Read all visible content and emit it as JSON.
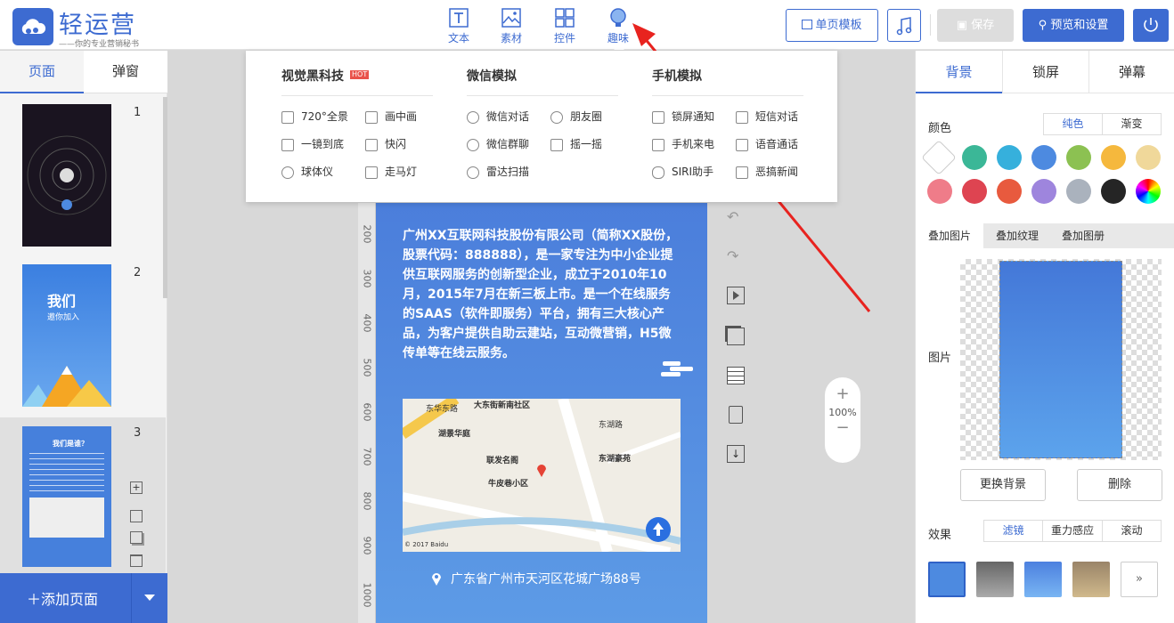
{
  "app": {
    "name": "轻运营",
    "slogan": "——你的专业营销秘书——"
  },
  "toolbar": {
    "tools": [
      {
        "label": "文本",
        "icon": "text-icon"
      },
      {
        "label": "素材",
        "icon": "image-icon"
      },
      {
        "label": "控件",
        "icon": "grid-icon"
      },
      {
        "label": "趣味",
        "icon": "lightbulb-icon"
      }
    ],
    "template_label": "单页模板",
    "save_label": "保存",
    "preview_label": "预览和设置"
  },
  "left": {
    "tabs": [
      "页面",
      "弹窗"
    ],
    "page_numbers": [
      "1",
      "2",
      "3"
    ],
    "thumb2_title": "我们",
    "thumb2_sub": "邀你加入",
    "thumb3_title": "我们是谁？",
    "add_page": "添加页面"
  },
  "dropdown": {
    "columns": [
      {
        "title": "视觉黑科技",
        "badge": "HOT",
        "items": [
          "720°全景",
          "画中画",
          "一镜到底",
          "快闪",
          "球体仪",
          "走马灯"
        ]
      },
      {
        "title": "微信模拟",
        "items": [
          "微信对话",
          "朋友圈",
          "微信群聊",
          "摇一摇",
          "雷达扫描"
        ]
      },
      {
        "title": "手机模拟",
        "items": [
          "锁屏通知",
          "短信对话",
          "手机来电",
          "语音通话",
          "SIRI助手",
          "恶搞新闻"
        ]
      }
    ]
  },
  "canvas": {
    "ruler": [
      "200",
      "300",
      "400",
      "500",
      "600",
      "700",
      "800",
      "900",
      "1000"
    ],
    "paragraph": "广州XX互联网科技股份有限公司（简称XX股份，股票代码：888888），是一家专注为中小企业提供互联网服务的创新型企业，成立于2010年10月，2015年7月在新三板上市。是一个在线服务的SAAS（软件即服务）平台，拥有三大核心产品，为客户提供自助云建站，互动微营销，H5微传单等在线云服务。",
    "address": "广东省广州市天河区花城广场88号",
    "map_labels": [
      "大东街新南社区",
      "湖景华庭",
      "联发名阁",
      "牛皮巷小区",
      "东湖豪苑",
      "东湖路",
      "东华东路",
      "© 2017 Baidu"
    ],
    "zoom": "100%"
  },
  "right": {
    "tabs": [
      "背景",
      "锁屏",
      "弹幕"
    ],
    "color_label": "颜色",
    "color_modes": [
      "纯色",
      "渐变"
    ],
    "swatches": [
      "#ffffff",
      "#3bb797",
      "#36b0dc",
      "#4d8ae0",
      "#8cc152",
      "#f5b83d",
      "#f0d89a",
      "#ef7c89",
      "#de4451",
      "#e85a3e",
      "#9e85dd",
      "#aab2bd",
      "#252525",
      "rainbow"
    ],
    "overlay_tabs": [
      "叠加图片",
      "叠加纹理",
      "叠加图册"
    ],
    "image_label": "图片",
    "replace_bg": "更换背景",
    "delete": "删除",
    "effect_label": "效果",
    "effect_modes": [
      "滤镜",
      "重力感应",
      "滚动"
    ],
    "accent": "#3d6bd1"
  }
}
